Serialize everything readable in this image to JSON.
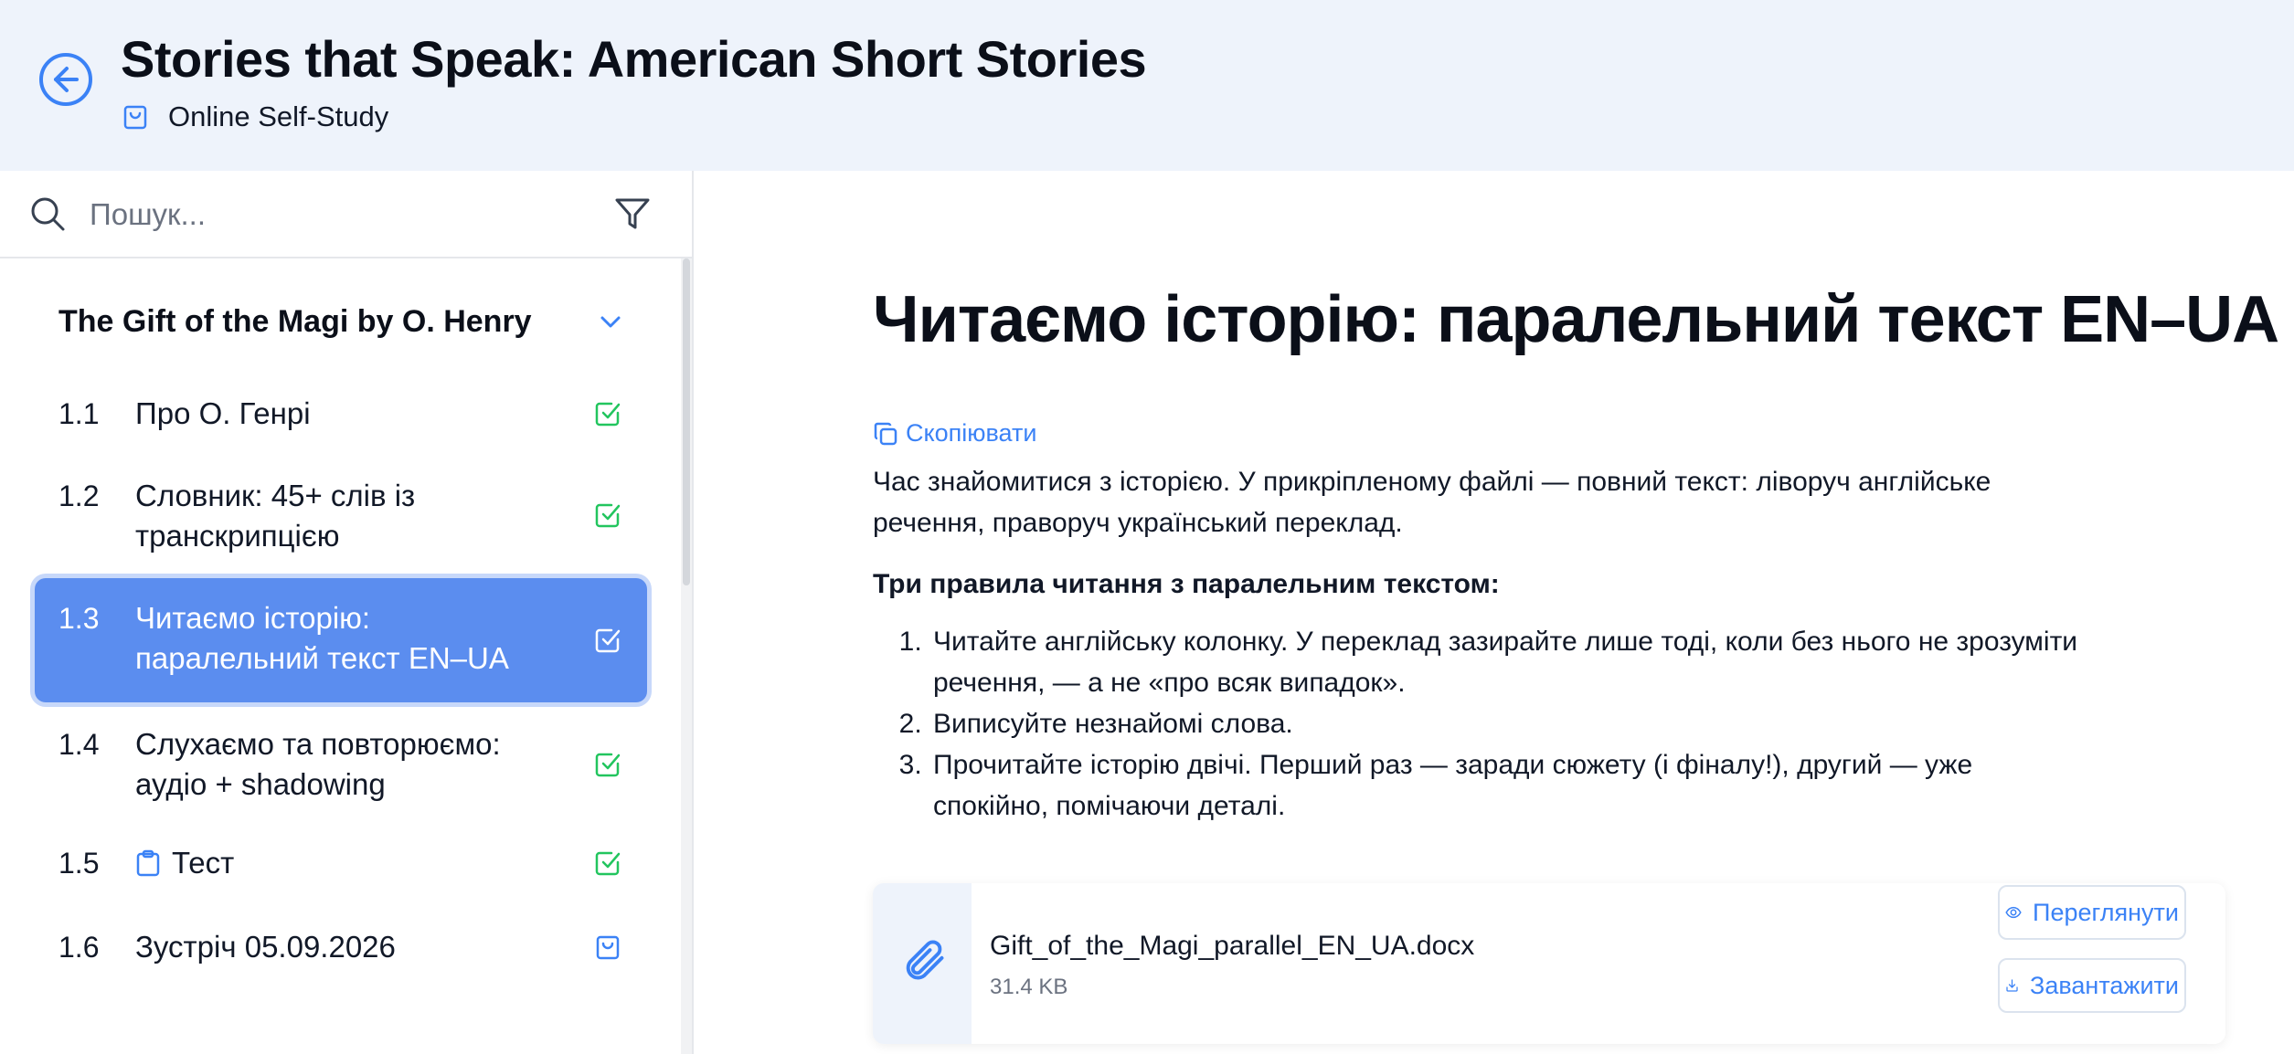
{
  "header": {
    "back_icon": "arrow-left-circle-icon",
    "title": "Stories that Speak: American Short Stories",
    "course_type_icon": "shopping-bag-icon",
    "course_type": "Online Self-Study",
    "accent": "#3b82f6",
    "background": "#eef3fb"
  },
  "sidebar": {
    "search_placeholder": "Пошук...",
    "search_value": "",
    "filter_icon": "filter-funnel-icon",
    "section": {
      "title": "The Gift of the Magi by O. Henry",
      "expanded": true
    },
    "lessons": [
      {
        "number": "1.1",
        "label": "Про О. Генрі",
        "status": "completed",
        "active": false
      },
      {
        "number": "1.2",
        "label": "Словник: 45+ слів із транскрипцією",
        "status": "completed",
        "active": false
      },
      {
        "number": "1.3",
        "label": "Читаємо історію: паралельний текст EN–UA",
        "status": "completed",
        "active": true
      },
      {
        "number": "1.4",
        "label": "Слухаємо та повторюємо: аудіо + shadowing",
        "status": "completed",
        "active": false
      },
      {
        "number": "1.5",
        "label": "Тест",
        "type_icon": "clipboard-icon",
        "status": "completed",
        "active": false
      },
      {
        "number": "1.6",
        "label": "Зустріч 05.09.2026",
        "status": "meeting",
        "active": false
      }
    ],
    "colors": {
      "active": "#5b8def",
      "completed": "#22c55e",
      "meeting": "#3b82f6"
    }
  },
  "content": {
    "title": "Читаємо історію: паралельний текст EN–UA",
    "copy_label": "Скопіювати",
    "intro": "Час знайомитися з історією. У прикріпленому файлі — повний текст: ліворуч англійське речення, праворуч український переклад.",
    "rules_heading": "Три правила читання з паралельним текстом:",
    "rules": [
      "Читайте англійську колонку. У переклад зазирайте лише тоді, коли без нього не зрозуміти речення, — а не «про всяк випадок».",
      "Виписуйте незнайомі слова.",
      "Прочитайте історію двічі. Перший раз — заради сюжету (і фіналу!), другий — уже спокійно, помічаючи деталі."
    ],
    "attachment": {
      "icon": "paperclip-icon",
      "filename": "Gift_of_the_Magi_parallel_EN_UA.docx",
      "size": "31.4 KB",
      "view_label": "Переглянути",
      "download_label": "Завантажити"
    }
  }
}
